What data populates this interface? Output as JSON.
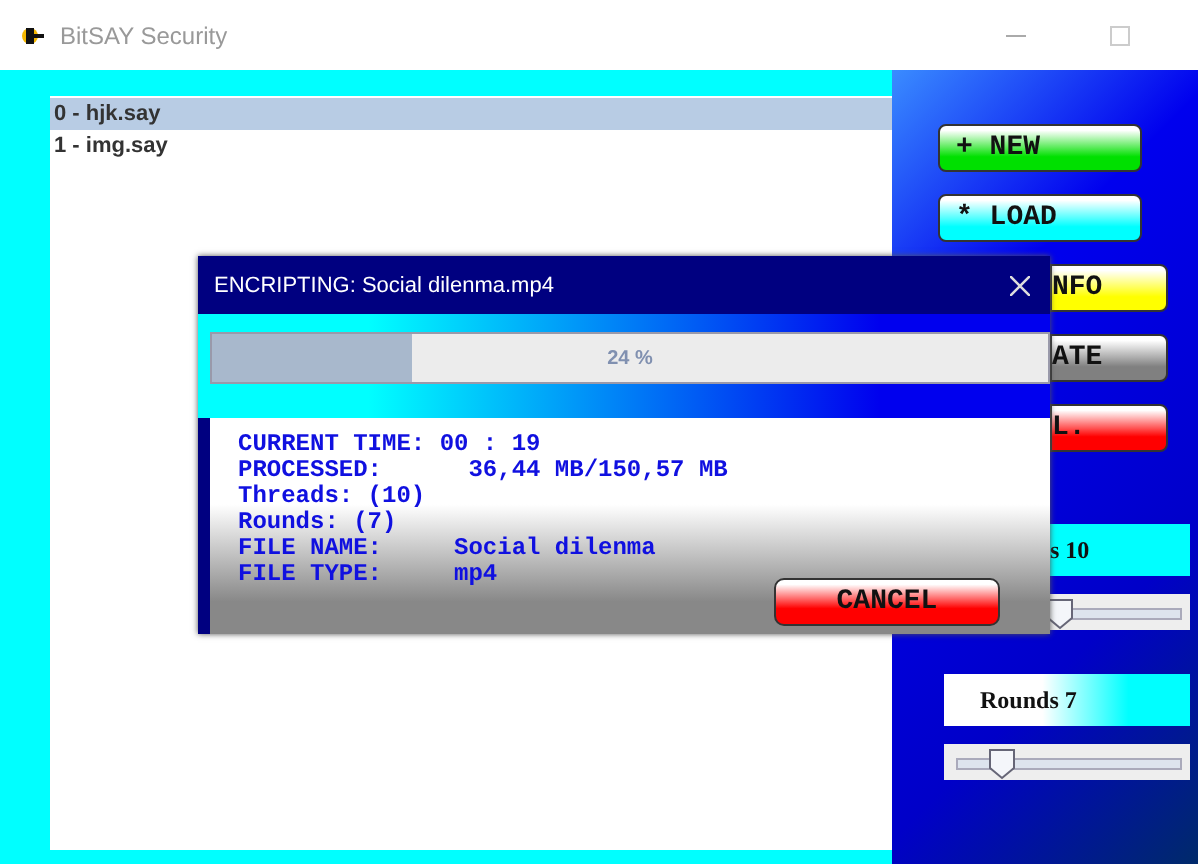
{
  "window": {
    "title": "BitSAY Security"
  },
  "files": [
    {
      "label": "0 - hjk.say",
      "selected": true
    },
    {
      "label": "1 - img.say",
      "selected": false
    }
  ],
  "buttons": [
    {
      "label": "+ NEW",
      "color": "#00e000",
      "kind": "whole"
    },
    {
      "label": "* LOAD",
      "color": "#00ffff",
      "kind": "whole"
    },
    {
      "label": "NFO",
      "color": "#ffff00",
      "kind": "clipped"
    },
    {
      "label": "ATE",
      "color": "#808080",
      "kind": "clipped"
    },
    {
      "label": "L.",
      "color": "#ff0000",
      "kind": "clipped"
    }
  ],
  "settings": [
    {
      "label": "s 10",
      "level": 0.46,
      "kind": "clipped"
    },
    {
      "label": "Rounds  7",
      "level": 0.2,
      "kind": "whole"
    }
  ],
  "dialog": {
    "title": "ENCRIPTING: Social dilenma.mp4",
    "progress": {
      "level": 0.24,
      "reading": "24 %"
    },
    "lines": [
      "CURRENT TIME: 00 : 19",
      "PROCESSED:      36,44 MB/150,57 MB",
      "Threads: (10)",
      "Rounds: (7)",
      "FILE NAME:     Social dilenma",
      "FILE TYPE:     mp4"
    ],
    "cancel": "CANCEL"
  }
}
